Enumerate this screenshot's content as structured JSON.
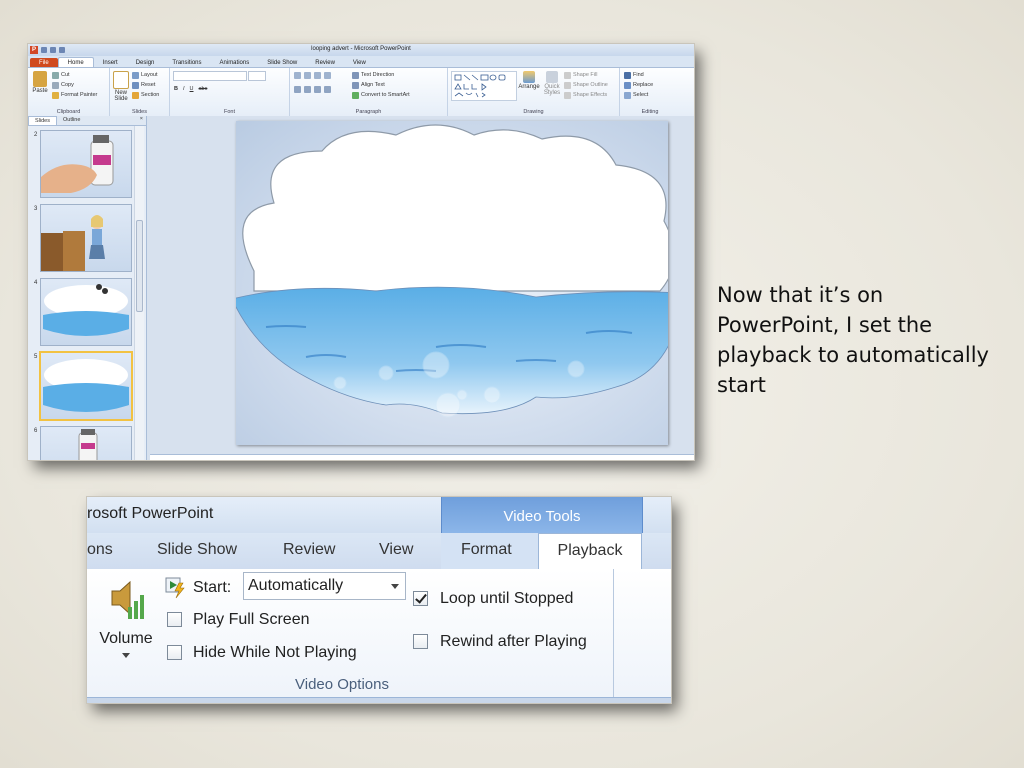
{
  "screenshot1": {
    "window_title": "looping advert - Microsoft PowerPoint",
    "app_icon": "P",
    "tabs": [
      "File",
      "Home",
      "Insert",
      "Design",
      "Transitions",
      "Animations",
      "Slide Show",
      "Review",
      "View"
    ],
    "active_tab": "Home",
    "ribbon": {
      "clipboard": {
        "paste": "Paste",
        "cut": "Cut",
        "copy": "Copy",
        "format_painter": "Format Painter",
        "label": "Clipboard"
      },
      "slides": {
        "new_slide": "New Slide",
        "layout": "Layout",
        "reset": "Reset",
        "section": "Section",
        "label": "Slides"
      },
      "font": {
        "label": "Font",
        "bold": "B",
        "italic": "I",
        "underline": "U",
        "strike": "abc"
      },
      "paragraph": {
        "label": "Paragraph",
        "text_direction": "Text Direction",
        "align_text": "Align Text",
        "smartart": "Convert to SmartArt"
      },
      "drawing": {
        "label": "Drawing",
        "arrange": "Arrange",
        "quick_styles": "Quick Styles",
        "shape_fill": "Shape Fill",
        "shape_outline": "Shape Outline",
        "shape_effects": "Shape Effects"
      },
      "editing": {
        "label": "Editing",
        "find": "Find",
        "replace": "Replace",
        "select": "Select"
      }
    },
    "panel_tabs": [
      "Slides",
      "Outline"
    ],
    "panel_close": "×",
    "slide_numbers": [
      "2",
      "3",
      "4",
      "5",
      "6"
    ],
    "selected_slide": "5"
  },
  "screenshot2": {
    "title_fragment": "rosoft PowerPoint",
    "context_title": "Video Tools",
    "tabs": [
      "ons",
      "Slide Show",
      "Review",
      "View",
      "Format",
      "Playback"
    ],
    "active_tab": "Playback",
    "volume_label": "Volume",
    "start_label": "Start:",
    "start_value": "Automatically",
    "options": [
      {
        "label": "Play Full Screen",
        "checked": false
      },
      {
        "label": "Hide While Not Playing",
        "checked": false
      },
      {
        "label": "Loop until Stopped",
        "checked": true
      },
      {
        "label": "Rewind after Playing",
        "checked": false
      }
    ],
    "group_label": "Video Options"
  },
  "caption": "Now that it’s on PowerPoint, I set the playback to automatically start",
  "colors": {
    "file_tab": "#d04a1e",
    "video_tools": "#6f9fdc",
    "water": "#5aaee6",
    "cloud": "#ffffff"
  }
}
